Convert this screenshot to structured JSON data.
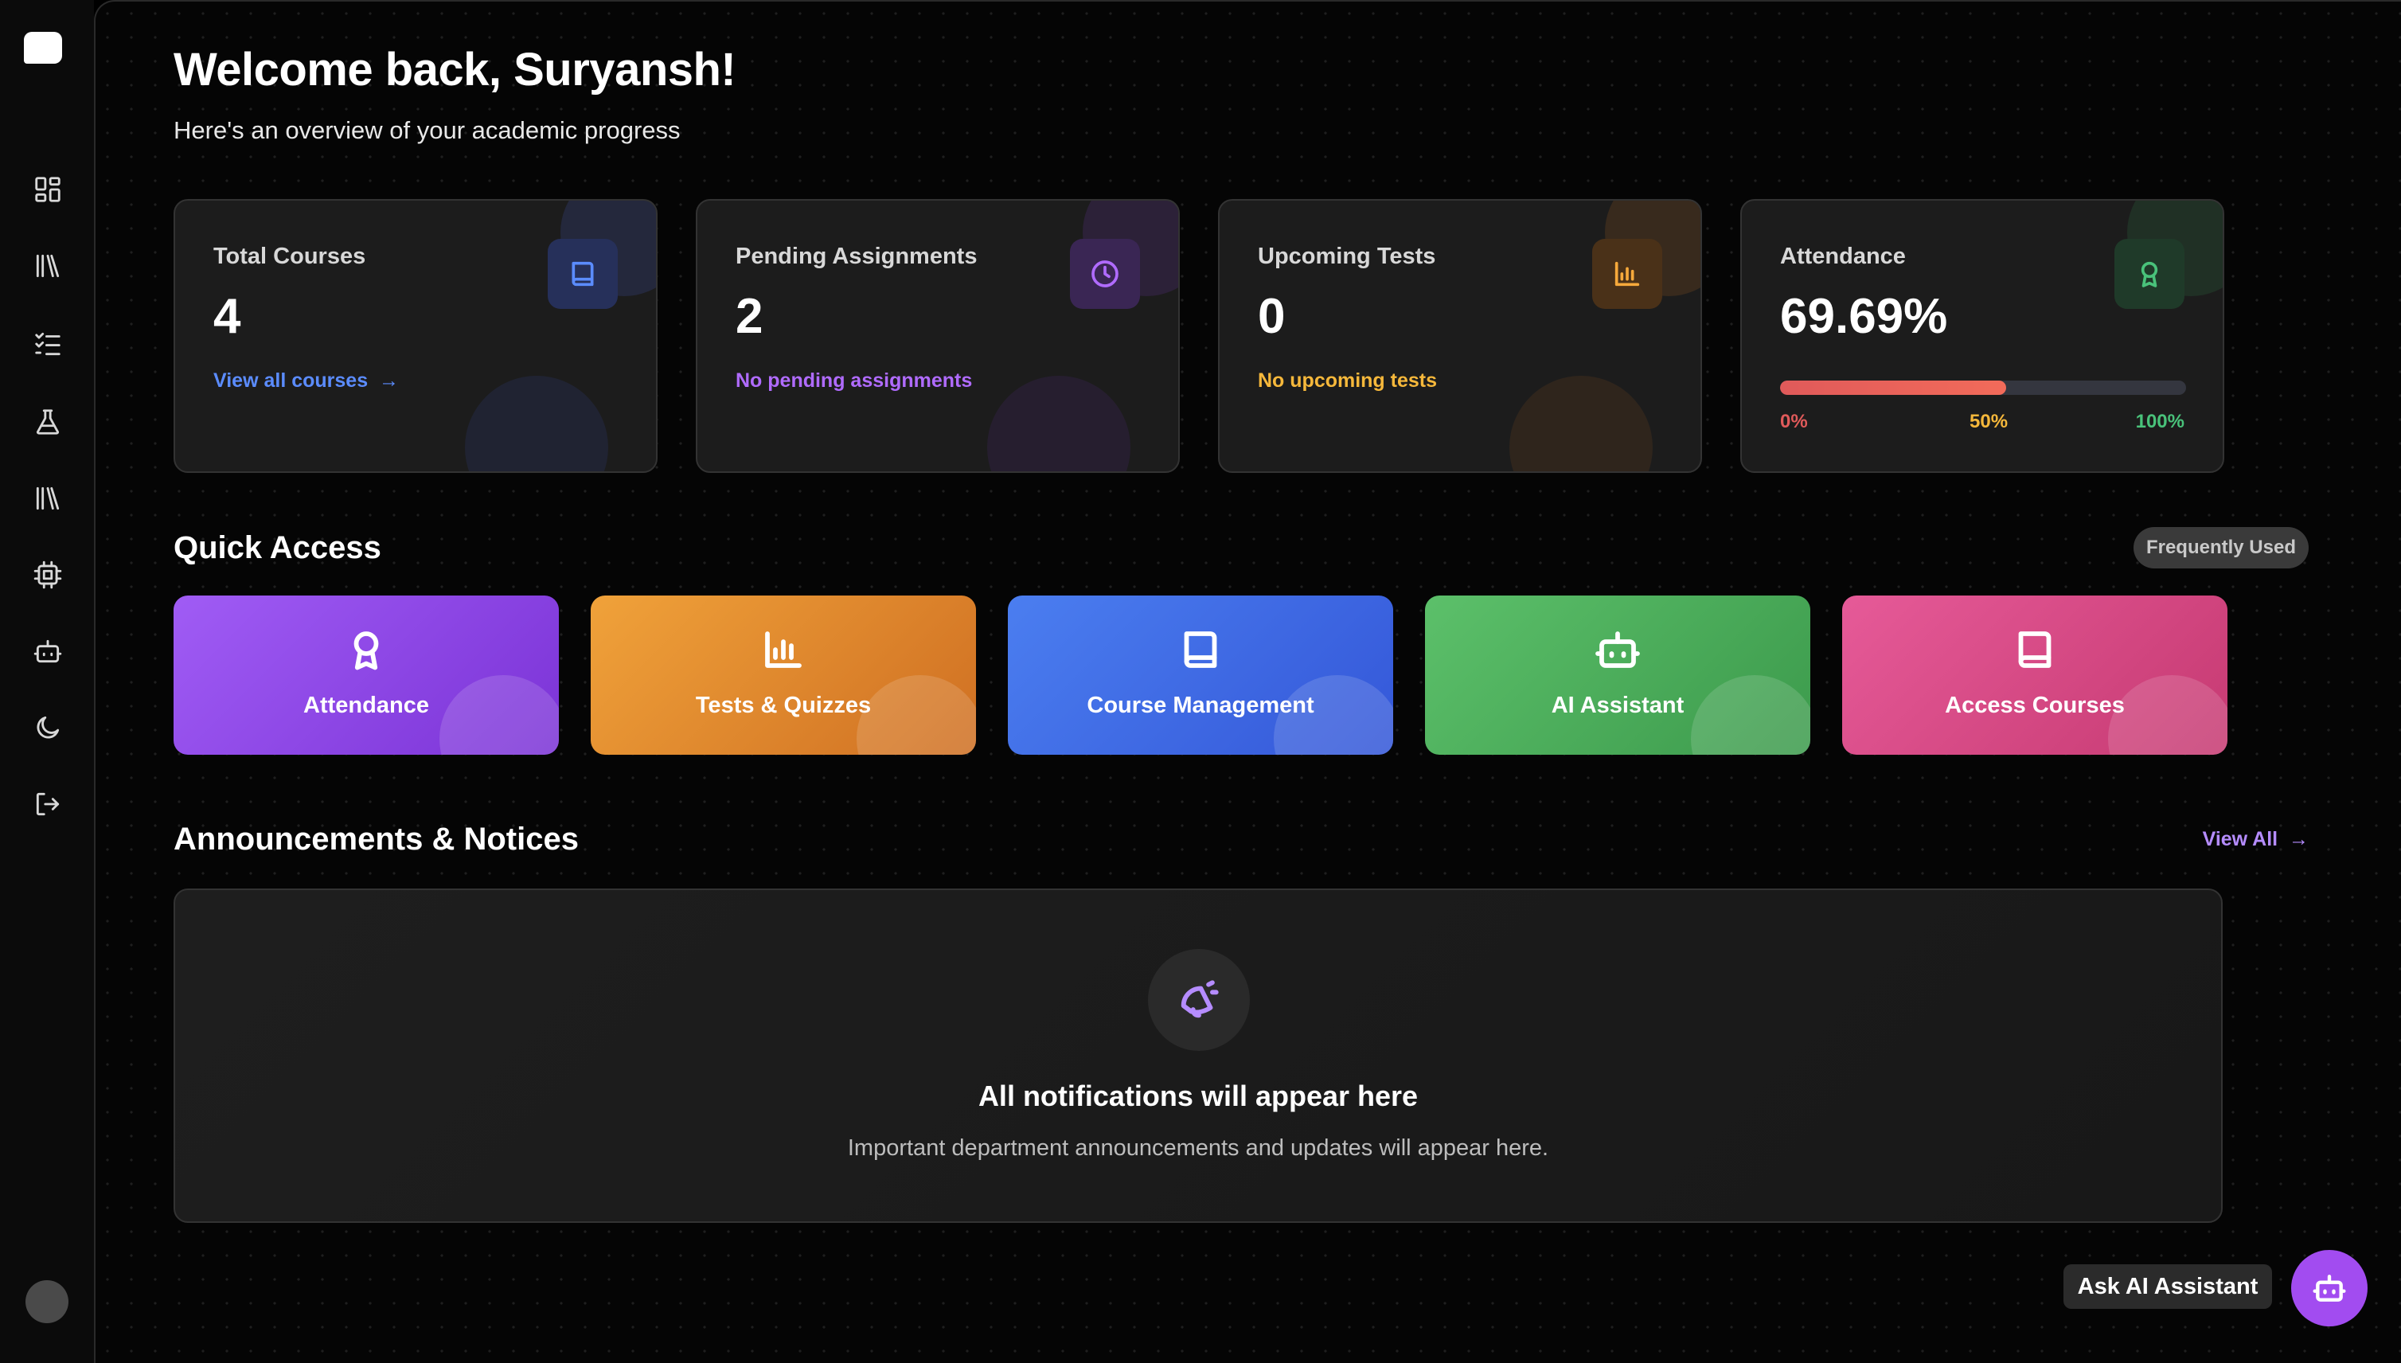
{
  "header": {
    "welcome": "Welcome back, Suryansh!",
    "subtitle": "Here's an overview of your academic progress"
  },
  "sidebar": {
    "items": [
      {
        "icon": "dashboard-icon"
      },
      {
        "icon": "library-icon"
      },
      {
        "icon": "checklist-icon"
      },
      {
        "icon": "flask-icon"
      },
      {
        "icon": "library-icon"
      },
      {
        "icon": "chip-icon"
      },
      {
        "icon": "bot-icon"
      },
      {
        "icon": "moon-icon"
      },
      {
        "icon": "logout-icon"
      }
    ]
  },
  "stats": {
    "courses": {
      "label": "Total Courses",
      "value": "4",
      "link": "View all courses",
      "accent": "#5b8cff",
      "icon": "book-icon"
    },
    "assignments": {
      "label": "Pending Assignments",
      "value": "2",
      "note": "No pending assignments",
      "accent": "#b06bff",
      "icon": "clock-icon"
    },
    "tests": {
      "label": "Upcoming Tests",
      "value": "0",
      "note": "No upcoming tests",
      "accent": "#f6a93b",
      "icon": "chart-icon"
    },
    "attendance": {
      "label": "Attendance",
      "value": "69.69%",
      "progress": 0.5575,
      "mark0": "0%",
      "mark50": "50%",
      "mark100": "100%",
      "accent": "#49c27a",
      "icon": "award-icon"
    }
  },
  "quick_access": {
    "title": "Quick Access",
    "badge": "Frequently Used",
    "items": [
      {
        "label": "Attendance",
        "icon": "award-icon",
        "color1": "#a05cf5",
        "color2": "#7b33d6"
      },
      {
        "label": "Tests & Quizzes",
        "icon": "chart-icon",
        "color1": "#f0a23a",
        "color2": "#cf6f22"
      },
      {
        "label": "Course Management",
        "icon": "book-icon",
        "color1": "#4b7ef0",
        "color2": "#3457d8"
      },
      {
        "label": "AI Assistant",
        "icon": "bot-icon",
        "color1": "#5cc06a",
        "color2": "#3c9a4c"
      },
      {
        "label": "Access Courses",
        "icon": "book-icon",
        "color1": "#e65a98",
        "color2": "#c63a72"
      }
    ]
  },
  "announcements": {
    "title": "Announcements & Notices",
    "view_all": "View All",
    "empty_title": "All notifications will appear here",
    "empty_sub": "Important department announcements and updates will appear here.",
    "icon": "megaphone-icon"
  },
  "assistant": {
    "label": "Ask AI Assistant",
    "icon": "bot-icon"
  }
}
